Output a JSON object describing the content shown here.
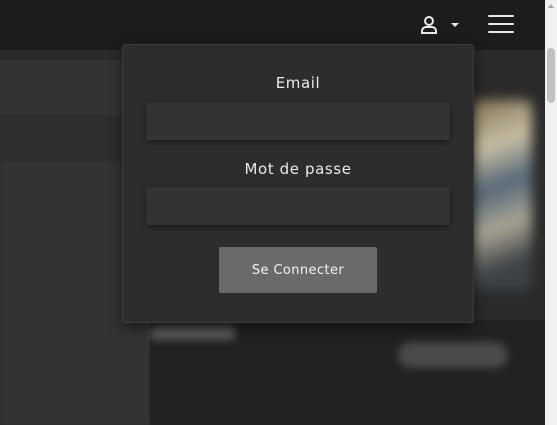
{
  "header": {
    "user_icon": "user-icon",
    "caret_icon": "caret-down-icon",
    "menu_icon": "hamburger-menu-icon"
  },
  "login": {
    "email_label": "Email",
    "email_value": "",
    "password_label": "Mot de passe",
    "password_value": "",
    "submit_label": "Se Connecter"
  },
  "colors": {
    "topbar": "#1c1c1c",
    "panel": "#2d2d2d",
    "input": "#333333",
    "button": "#6a6a6a"
  }
}
